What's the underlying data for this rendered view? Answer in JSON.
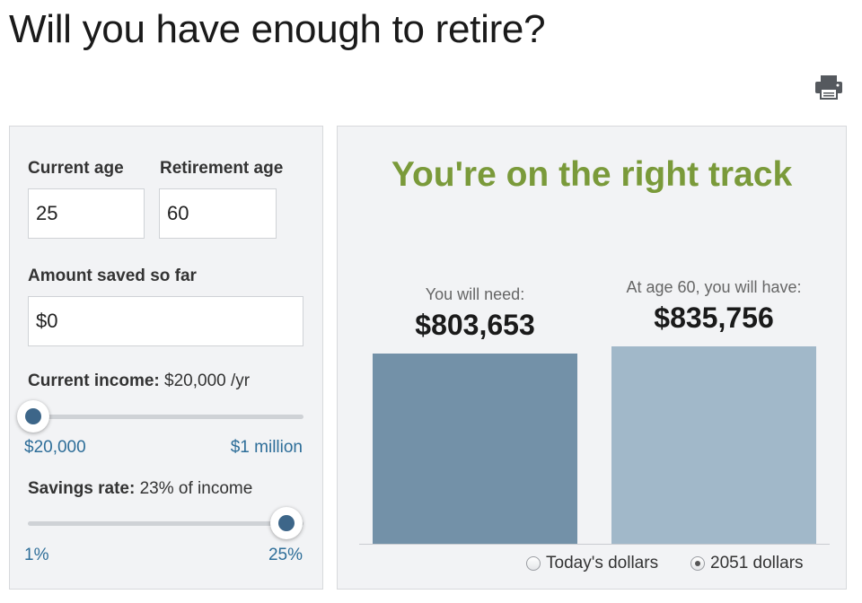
{
  "page": {
    "title": "Will you have enough to retire?"
  },
  "toolbar": {
    "print_icon": "printer-icon"
  },
  "inputs": {
    "current_age": {
      "label": "Current age",
      "value": "25"
    },
    "retirement_age": {
      "label": "Retirement age",
      "value": "60"
    },
    "amount_saved": {
      "label": "Amount saved so far",
      "value": "$0"
    }
  },
  "income": {
    "label": "Current income:",
    "value": "$20,000 /yr",
    "min_label": "$20,000",
    "max_label": "$1 million",
    "slider_fraction": 0.0
  },
  "savings_rate": {
    "label": "Savings rate:",
    "value": "23%  of income",
    "min_label": "1%",
    "max_label": "25%",
    "slider_fraction": 0.917
  },
  "result": {
    "headline": "You're on the right track",
    "headline_color": "#7a9a3a"
  },
  "chart_data": {
    "type": "bar",
    "categories": [
      "You will need:",
      "At age 60, you will have:"
    ],
    "values": [
      803653,
      835756
    ],
    "value_labels": [
      "$803,653",
      "$835,756"
    ],
    "colors": [
      "#7391a8",
      "#a1b8c9"
    ],
    "ylim": [
      0,
      835756
    ]
  },
  "dollars_toggle": {
    "options": [
      "Today's dollars",
      "2051 dollars"
    ],
    "selected": "2051 dollars"
  }
}
